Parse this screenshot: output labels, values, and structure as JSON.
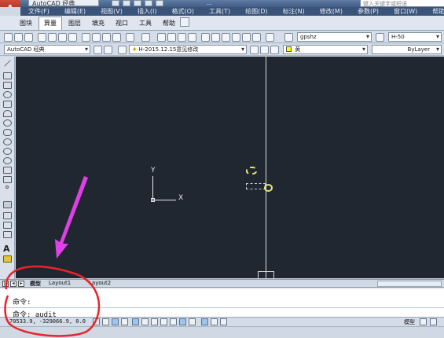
{
  "title_bar": {
    "workspace_name": "AutoCAD 经典",
    "document_title": "…",
    "search_placeholder": "键入关键字或短语"
  },
  "menu": [
    "文件(F)",
    "编辑(E)",
    "视图(V)",
    "插入(I)",
    "格式(O)",
    "工具(T)",
    "绘图(D)",
    "标注(N)",
    "修改(M)",
    "参数(P)",
    "窗口(W)",
    "帮助(H)"
  ],
  "ribbon_tabs": [
    "图块",
    "算量",
    "图层",
    "填充",
    "视口",
    "工具",
    "帮助"
  ],
  "ribbon_active_tab": "算量",
  "toolbar1": {
    "text_style": "gpshz",
    "dim_style": "H-50"
  },
  "toolbar2": {
    "workspace": "AutoCAD 经典",
    "layer": "H-2015.12.15意见修改",
    "color": "黄",
    "linetype": "ByLayer"
  },
  "ucs": {
    "x_label": "X",
    "y_label": "Y"
  },
  "layout_tabs": [
    "模型",
    "Layout1",
    "Layout2"
  ],
  "command_history": [
    "命令:",
    "命令: audit"
  ],
  "status": {
    "coordinates": "70533.9, -329066.9, 0.0",
    "model_label": "模型"
  },
  "colors": {
    "canvas": "#212730",
    "annotation_red": "#e8242a",
    "annotation_arrow": "#e040e8",
    "layer_color": "#ffff00"
  }
}
